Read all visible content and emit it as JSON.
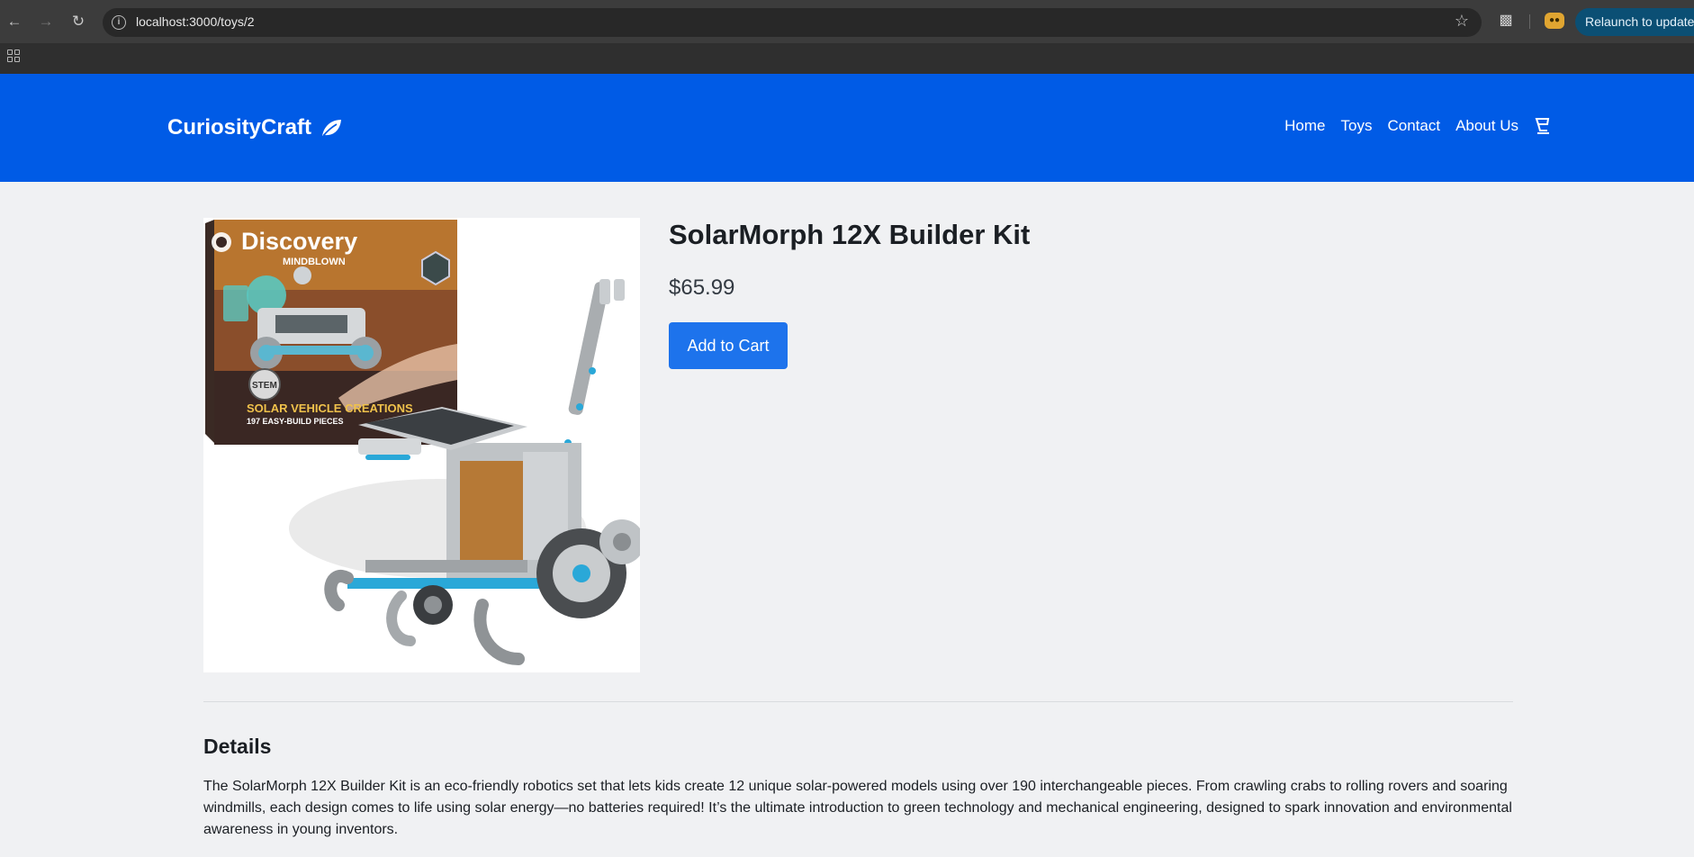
{
  "browser": {
    "url": "localhost:3000/toys/2",
    "relaunch_label": "Relaunch to update",
    "icons": [
      "back-icon",
      "forward-icon",
      "reload-icon",
      "info-icon",
      "star-icon",
      "extensions-icon",
      "profile-icon",
      "apps-icon"
    ]
  },
  "site": {
    "brand": "CuriosityCraft",
    "brand_icon": "leaf-icon",
    "nav": {
      "home": "Home",
      "toys": "Toys",
      "contact": "Contact",
      "about": "About Us"
    },
    "cart_icon": "cart-icon",
    "colors": {
      "header": "#005be6",
      "button": "#1d73ec",
      "background": "#f0f1f3"
    }
  },
  "product": {
    "title": "SolarMorph 12X Builder Kit",
    "price": "$65.99",
    "add_to_cart_label": "Add to Cart",
    "image": {
      "box_brand": "Discovery",
      "box_subbrand": "MINDBLOWN",
      "box_caption": "SOLAR VEHICLE CREATIONS",
      "box_subcaption": "197 EASY-BUILD PIECES",
      "stem_badge": "STEM"
    }
  },
  "details": {
    "heading": "Details",
    "body": "The SolarMorph 12X Builder Kit is an eco-friendly robotics set that lets kids create 12 unique solar-powered models using over 190 interchangeable pieces. From crawling crabs to rolling rovers and soaring windmills, each design comes to life using solar energy—no batteries required! It’s the ultimate introduction to green technology and mechanical engineering, designed to spark innovation and environmental awareness in young inventors."
  }
}
